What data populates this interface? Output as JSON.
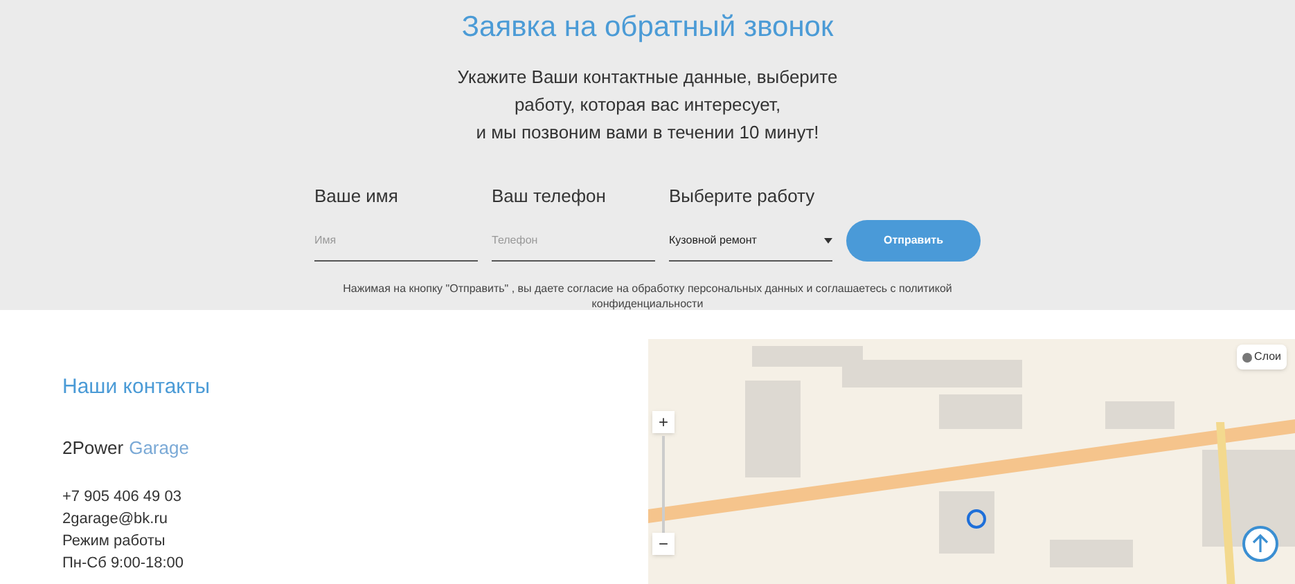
{
  "callback": {
    "title": "Заявка на обратный звонок",
    "description": "Укажите Ваши контактные данные, выберите\nработу, которая вас интересует,\nи мы позвоним вами в течении 10 минут!",
    "fields": [
      {
        "kind": "input",
        "label": "Ваше имя",
        "placeholder": "Имя"
      },
      {
        "kind": "input",
        "label": "Ваш телефон",
        "placeholder": "Телефон"
      },
      {
        "kind": "select",
        "label": "Выберите работу",
        "value": "Кузовной ремонт"
      }
    ],
    "submit": "Отправить",
    "consent": "Нажимая на кнопку \"Отправить\" , вы даете согласие на обработку персональных данных и соглашаетесь с политикой конфиденциальности"
  },
  "contacts": {
    "title": "Наши контакты",
    "brand": "2Power",
    "brand_accent": "Garage",
    "lines": [
      "+7 905 406 49 03",
      "2garage@bk.ru",
      "Режим работы",
      "Пн-Сб 9:00-18:00"
    ]
  },
  "map": {
    "layers_button": "Слои",
    "zoom_in": "+",
    "zoom_out": "−"
  }
}
